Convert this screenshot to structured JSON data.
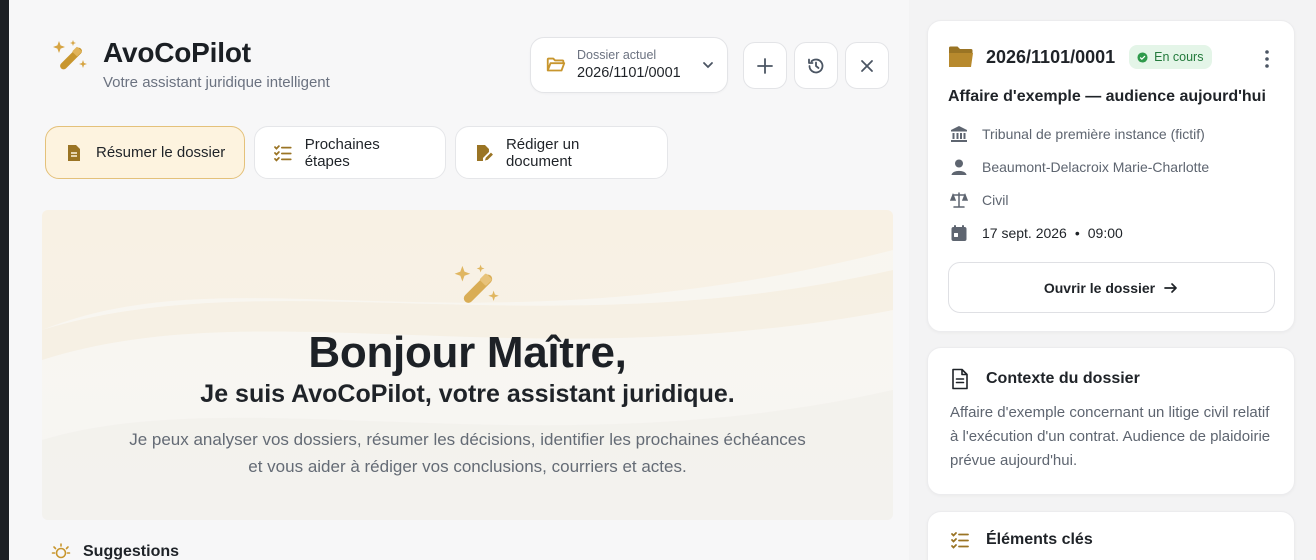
{
  "brand": {
    "title": "AvoCoPilot",
    "subtitle": "Votre assistant juridique intelligent"
  },
  "dossier_selector": {
    "label": "Dossier actuel",
    "value": "2026/1101/0001"
  },
  "toolbar": {
    "new_icon": "plus-icon",
    "history_icon": "history-icon",
    "close_icon": "close-icon"
  },
  "actions": [
    {
      "label": "Résumer le dossier",
      "icon": "document-icon",
      "active": true
    },
    {
      "label": "Prochaines étapes",
      "icon": "checklist-icon",
      "active": false
    },
    {
      "label": "Rédiger un document",
      "icon": "document-edit-icon",
      "active": false
    }
  ],
  "hero": {
    "title": "Bonjour Maître,",
    "subtitle": "Je suis AvoCoPilot, votre assistant juridique.",
    "desc_line1": "Je peux analyser vos dossiers, résumer les décisions, identifier les prochaines échéances",
    "desc_line2": "et vous aider à rédiger vos conclusions, courriers et actes."
  },
  "suggestions": {
    "label": "Suggestions"
  },
  "dossier_card": {
    "reference": "2026/1101/0001",
    "status": "En cours",
    "title": "Affaire d'exemple — audience aujourd'hui",
    "court": "Tribunal de première instance (fictif)",
    "client": "Beaumont-Delacroix Marie-Charlotte",
    "matter": "Civil",
    "date": "17 sept. 2026",
    "time": "09:00",
    "open_label": "Ouvrir le dossier"
  },
  "context_card": {
    "title": "Contexte du dossier",
    "text": "Affaire d'exemple concernant un litige civil relatif à l'exécution d'un contrat. Audience de plaidoirie prévue aujourd'hui."
  },
  "key_elements_card": {
    "title": "Éléments clés"
  },
  "colors": {
    "accent": "#c8962e",
    "active_bg": "#fdf3df",
    "status_bg": "#e4f5e8",
    "status_fg": "#237a3c"
  }
}
